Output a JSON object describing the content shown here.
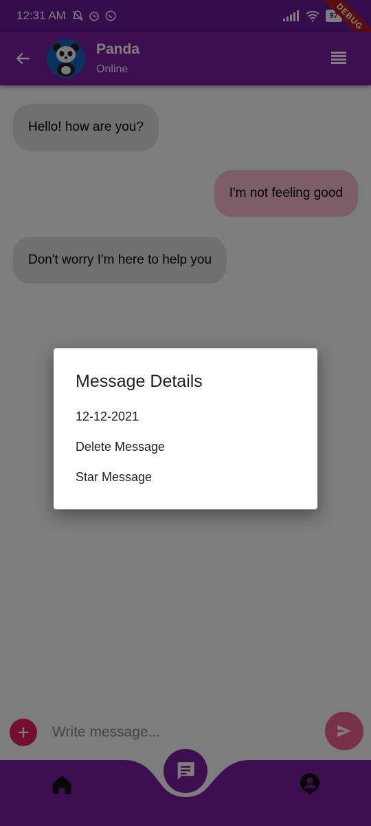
{
  "status_bar": {
    "time": "12:31 AM",
    "battery": "97",
    "debug_label": "DEBUG",
    "icons": [
      "mute-icon",
      "alarm-icon",
      "whatsapp-icon",
      "signal-icon",
      "wifi-icon",
      "battery-icon"
    ]
  },
  "app_bar": {
    "contact_name": "Panda",
    "presence": "Online",
    "back_icon": "arrow-back-icon",
    "menu_icon": "menu-lines-icon"
  },
  "messages": [
    {
      "text": "Hello! how are you?",
      "direction": "incoming"
    },
    {
      "text": "I'm not feeling good",
      "direction": "outgoing"
    },
    {
      "text": "Don't worry I'm here to help you",
      "direction": "incoming"
    }
  ],
  "composer": {
    "placeholder": "Write message...",
    "add_icon": "plus-icon",
    "send_icon": "send-icon"
  },
  "bottom_nav": {
    "items": [
      "home-icon",
      "chat-icon",
      "profile-icon"
    ]
  },
  "dialog": {
    "title": "Message Details",
    "items": [
      "12-12-2021",
      "Delete Message",
      "Star Message"
    ]
  },
  "colors": {
    "primary": "#7b1fa2",
    "accent": "#e91e63",
    "incoming_bubble": "#e0e0e0",
    "outgoing_bubble": "#f8bbd0"
  }
}
